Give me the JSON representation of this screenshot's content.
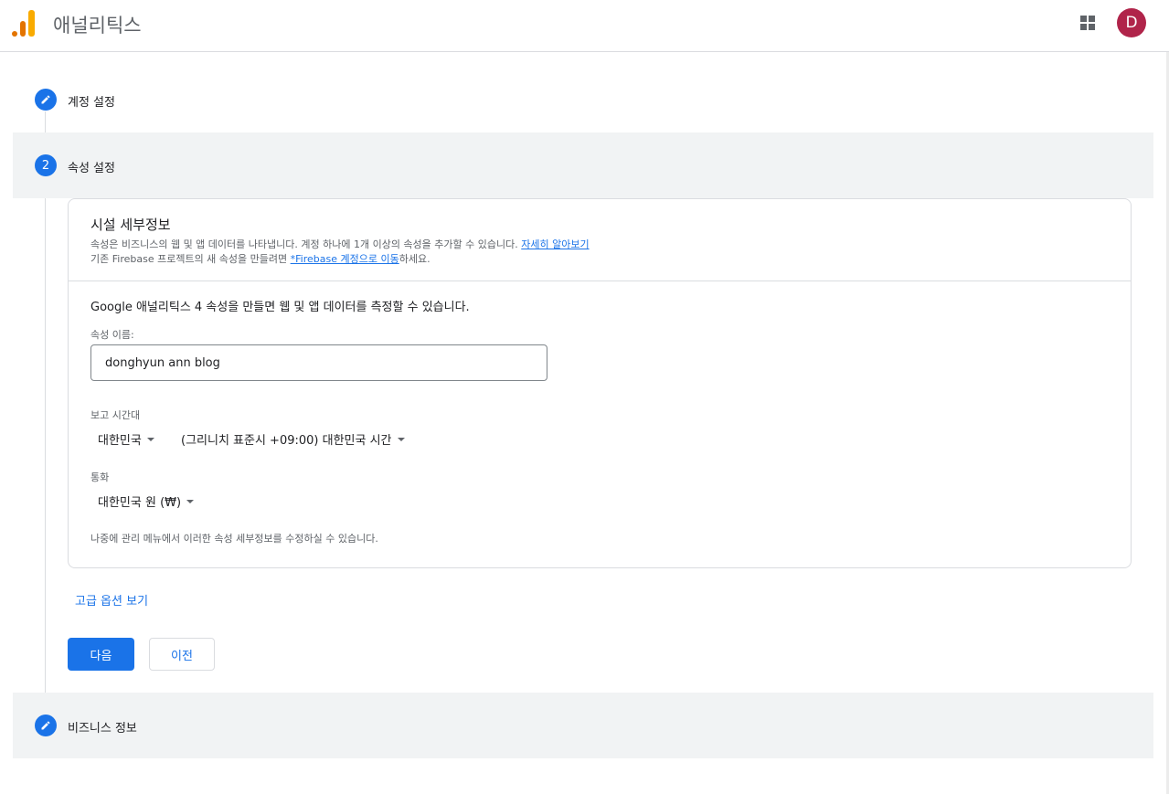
{
  "header": {
    "app_title": "애널리틱스",
    "apps_icon": "apps-grid-icon",
    "avatar_initial": "D",
    "avatar_color": "#b0244a"
  },
  "steps": [
    {
      "label": "계정 설정",
      "marker": "✎",
      "icon": "edit-pencil-icon",
      "state": "completed"
    },
    {
      "label": "속성 설정",
      "marker": "2",
      "state": "active"
    },
    {
      "label": "비즈니스 정보",
      "marker": "✎",
      "icon": "edit-pencil-icon",
      "state": "completed"
    }
  ],
  "card": {
    "title": "시설 세부정보",
    "desc1_text": "속성은 비즈니스의 웹 및 앱 데이터를 나타냅니다. 계정 하나에 1개 이상의 속성을 추가할 수 있습니다.",
    "desc1_link": "자세히 알아보기",
    "desc2_pre": "기존 Firebase 프로젝트의 새 속성을 만들려면",
    "desc2_link": "*Firebase 계정으로 이동",
    "desc2_post": "하세요.",
    "lead": "Google 애널리틱스 4 속성을 만들면 웹 및 앱 데이터를 측정할 수 있습니다.",
    "property_name_label": "속성 이름:",
    "property_name_value": "donghyun ann blog",
    "timezone_label": "보고 시간대",
    "timezone_country": "대한민국",
    "timezone_value": "(그리니치 표준시 +09:00) 대한민국 시간",
    "currency_label": "통화",
    "currency_value": "대한민국 원 (₩)",
    "note": "나중에 관리 메뉴에서 이러한 속성 세부정보를 수정하실 수 있습니다."
  },
  "actions": {
    "advanced_link": "고급 옵션 보기",
    "next_button": "다음",
    "prev_button": "이전"
  },
  "colors": {
    "accent": "#1a73e8",
    "step_bg": "#f1f3f4",
    "logo_orange": "#e37400",
    "logo_yellow": "#f9ab00"
  }
}
